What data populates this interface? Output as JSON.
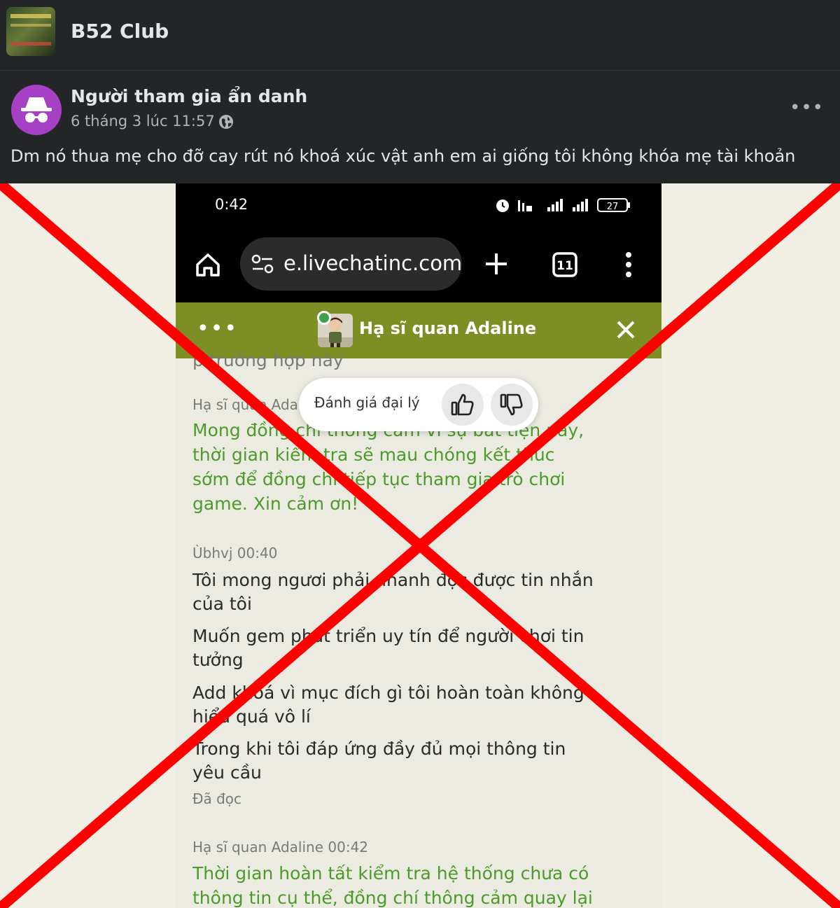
{
  "group": {
    "name": "B52 Club"
  },
  "post": {
    "author": "Người tham gia ẩn danh",
    "time": "6 tháng 3 lúc 11:57 ·",
    "more": "•••",
    "text": "Dm nó thua mẹ cho đỡ cay rút nó khoá xúc vật anh em ai giống tôi không khóa mẹ tài khoản"
  },
  "phone": {
    "status_time": "0:42",
    "battery": "27",
    "url": "e.livechatinc.com",
    "tab_count": "11"
  },
  "chat": {
    "menu": "•••",
    "agent_name": "Hạ sĩ quan Adaline",
    "rating_label": "Đánh giá đại lý",
    "messages": [
      {
        "kind": "cut",
        "text": "p trường hợp này"
      },
      {
        "kind": "meta",
        "text": "Hạ sĩ quan Adaline"
      },
      {
        "kind": "agent",
        "text": "Mong đồng chí thông cảm vì sự bất tiện này,"
      },
      {
        "kind": "agent",
        "text": "thời gian kiểm tra sẽ mau chóng kết thúc"
      },
      {
        "kind": "agent",
        "text": "sớm để đồng chí tiếp tục tham gia trò chơi"
      },
      {
        "kind": "agent",
        "text": "game. Xin cảm ơn!"
      },
      {
        "kind": "meta",
        "text": "Ùbhvj 00:40"
      },
      {
        "kind": "user",
        "text": "Tôi mong ngươi phải nhanh đọc được tin nhắn"
      },
      {
        "kind": "user",
        "text": "của tôi"
      },
      {
        "kind": "user",
        "text": "Muốn gem phát triển uy tín để người chơi tin"
      },
      {
        "kind": "user",
        "text": "tưởng"
      },
      {
        "kind": "user",
        "text": "Add khoá vì mục đích gì tôi hoàn toàn không"
      },
      {
        "kind": "user",
        "text": "hiểu quá vô lí"
      },
      {
        "kind": "user",
        "text": "Trong khi tôi đáp ứng đầy đủ mọi thông tin"
      },
      {
        "kind": "user",
        "text": "yêu cầu"
      },
      {
        "kind": "meta",
        "text": "Đã đọc"
      },
      {
        "kind": "meta",
        "text": "Hạ sĩ quan Adaline 00:42"
      },
      {
        "kind": "agent",
        "text": "Thời gian hoàn tất kiểm tra hệ thống chưa có"
      },
      {
        "kind": "agent",
        "text": "thông tin cụ thể, đồng chí thông cảm quay lại"
      }
    ]
  },
  "colors": {
    "facebook_dark": "#242526",
    "chat_header": "#7d8e24",
    "agent_text": "#4b9a2a",
    "cross": "#ff0000",
    "avatar": "#a640c4"
  }
}
